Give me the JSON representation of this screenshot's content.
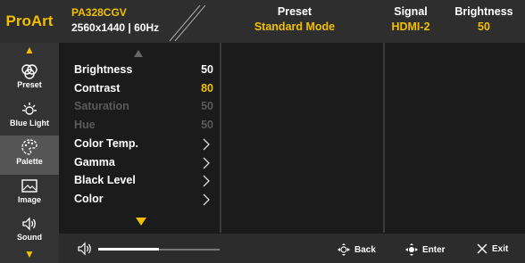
{
  "header": {
    "brand": "ProArt",
    "model": "PA328CGV",
    "resolution": "2560x1440 | 60Hz",
    "preset": {
      "title": "Preset",
      "value": "Standard Mode"
    },
    "signal": {
      "title": "Signal",
      "value": "HDMI-2"
    },
    "brightness": {
      "title": "Brightness",
      "value": "50"
    }
  },
  "sidebar": {
    "items": [
      {
        "label": "Preset",
        "icon": "preset-icon"
      },
      {
        "label": "Blue Light",
        "icon": "blue-light-icon"
      },
      {
        "label": "Palette",
        "icon": "palette-icon",
        "active": true
      },
      {
        "label": "Image",
        "icon": "image-icon"
      },
      {
        "label": "Sound",
        "icon": "sound-icon"
      }
    ]
  },
  "menu": {
    "items": [
      {
        "label": "Brightness",
        "value": "50"
      },
      {
        "label": "Contrast",
        "value": "80",
        "highlight": true
      },
      {
        "label": "Saturation",
        "value": "50",
        "disabled": true
      },
      {
        "label": "Hue",
        "value": "50",
        "disabled": true
      },
      {
        "label": "Color Temp."
      },
      {
        "label": "Gamma"
      },
      {
        "label": "Black Level"
      },
      {
        "label": "Color"
      }
    ]
  },
  "footer": {
    "volume_level": 0.5,
    "back": "Back",
    "enter": "Enter",
    "exit": "Exit"
  },
  "colors": {
    "accent": "#f0c000",
    "background": "#1b1b1b",
    "active": "#555555"
  }
}
